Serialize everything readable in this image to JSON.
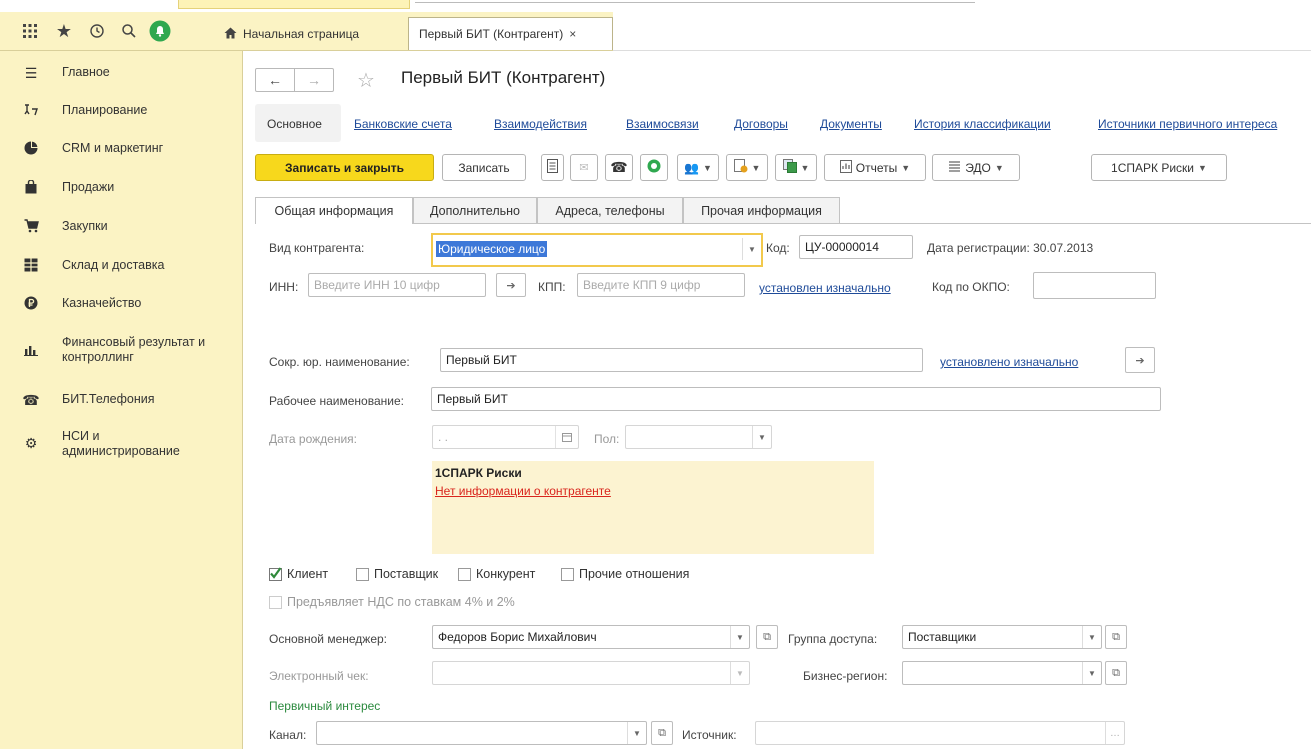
{
  "tabs": {
    "home": "Начальная страница",
    "active": "Первый БИТ (Контрагент)",
    "close_glyph": "×"
  },
  "topbar_icons": [
    "apps-grid-icon",
    "star-icon",
    "history-icon",
    "search-icon",
    "notifications-bell-icon",
    "home-icon"
  ],
  "sidebar": {
    "items": [
      {
        "label": "Главное",
        "icon": "menu-lines-icon"
      },
      {
        "label": "Планирование",
        "icon": "planning-icon"
      },
      {
        "label": "CRM и маркетинг",
        "icon": "pie-chart-icon"
      },
      {
        "label": "Продажи",
        "icon": "shopping-bag-icon"
      },
      {
        "label": "Закупки",
        "icon": "cart-icon"
      },
      {
        "label": "Склад и доставка",
        "icon": "warehouse-icon"
      },
      {
        "label": "Казначейство",
        "icon": "ruble-coin-icon"
      },
      {
        "label": "Финансовый результат и контроллинг",
        "icon": "bar-chart-icon"
      },
      {
        "label": "БИТ.Телефония",
        "icon": "telephone-icon"
      },
      {
        "label": "НСИ и администрирование",
        "icon": "gear-icon"
      }
    ]
  },
  "page": {
    "title": "Первый БИТ (Контрагент)",
    "back_glyph": "←",
    "forward_glyph": "→",
    "star_glyph": "☆"
  },
  "nav_links": {
    "main": "Основное",
    "items": [
      "Банковские счета",
      "Взаимодействия",
      "Взаимосвязи",
      "Договоры",
      "Документы",
      "История классификации",
      "Источники первичного интереса"
    ]
  },
  "toolbar": {
    "save_close": "Записать и закрыть",
    "save": "Записать",
    "reports": "Отчеты",
    "edo": "ЭДО",
    "spark": "1СПАРК Риски"
  },
  "form_tabs": [
    "Общая информация",
    "Дополнительно",
    "Адреса, телефоны",
    "Прочая информация"
  ],
  "form": {
    "kind_label": "Вид контрагента:",
    "kind_value": "Юридическое лицо",
    "code_label": "Код:",
    "code_value": "ЦУ-00000014",
    "reg_date": "Дата регистрации: 30.07.2013",
    "inn_label": "ИНН:",
    "inn_placeholder": "Введите ИНН 10 цифр",
    "kpp_label": "КПП:",
    "kpp_placeholder": "Введите КПП 9 цифр",
    "set_initially_m": "установлен изначально",
    "okpo_label": "Код по ОКПО:",
    "okpo_value": "",
    "short_name_label": "Сокр. юр. наименование:",
    "short_name_value": "Первый БИТ",
    "set_initially_n": "установлено изначально",
    "work_name_label": "Рабочее наименование:",
    "work_name_value": "Первый БИТ",
    "birth_label": "Дата рождения:",
    "birth_value": " .  .",
    "gender_label": "Пол:",
    "spark_title": "1СПАРК Риски",
    "spark_msg": "Нет информации о контрагенте",
    "cb_client": "Клиент",
    "cb_supplier": "Поставщик",
    "cb_competitor": "Конкурент",
    "cb_other": "Прочие отношения",
    "cb_vat": "Предъявляет НДС по ставкам 4% и 2%",
    "manager_label": "Основной менеджер:",
    "manager_value": "Федоров Борис Михайлович",
    "access_label": "Группа доступа:",
    "access_value": "Поставщики",
    "echeck_label": "Электронный чек:",
    "region_label": "Бизнес-регион:",
    "interest_head": "Первичный интерес",
    "channel_label": "Канал:",
    "source_label": "Источник:"
  },
  "colors": {
    "sidebar_bg": "#fbf3c4",
    "primary_button": "#f7d81c",
    "link": "#1f4b99",
    "warning_text": "#d9251d",
    "section_green": "#2b8a3e",
    "spark_bg": "#fcf3d1"
  }
}
